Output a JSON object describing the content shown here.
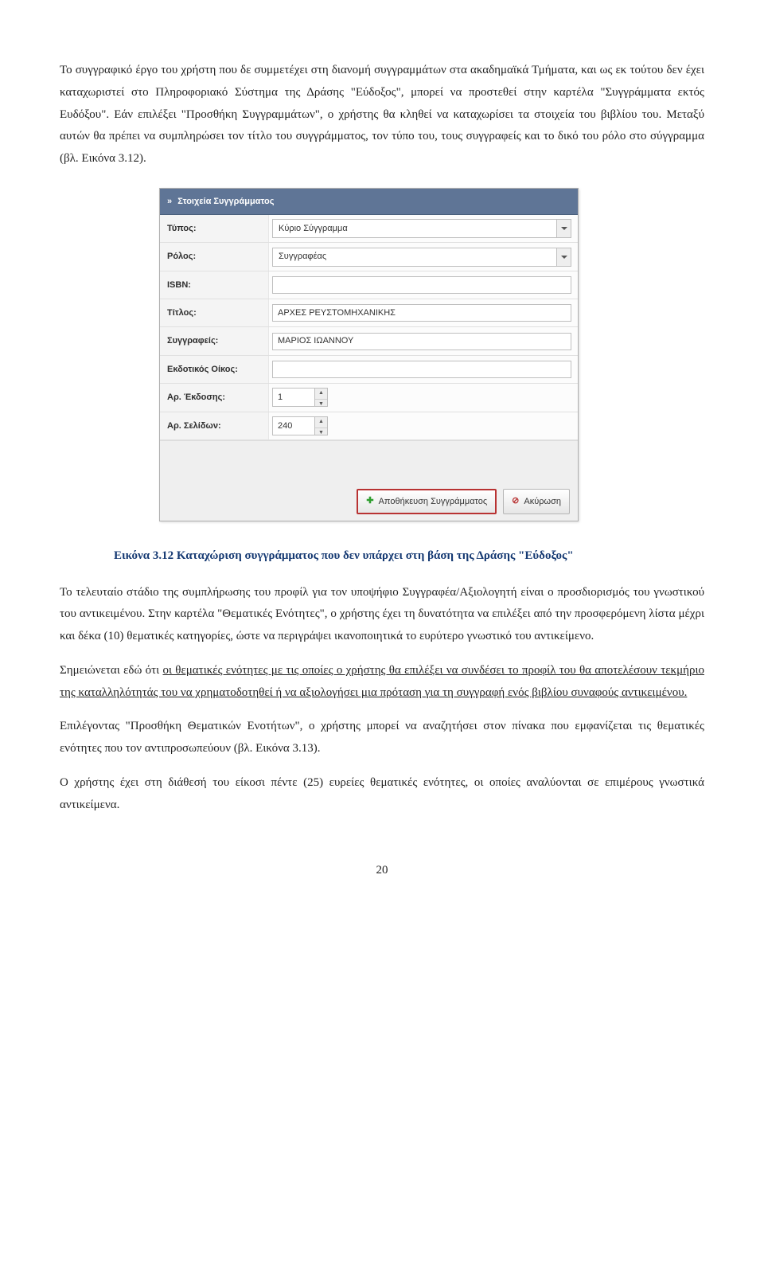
{
  "paragraphs": {
    "p1": "To συγγραφικό έργο του χρήστη που δε συμμετέχει στη διανομή συγγραμμάτων στα ακαδημαϊκά Τμήματα, και ως εκ τούτου δεν έχει καταχωριστεί στο Πληροφοριακό Σύστημα της Δράσης \"Εύδοξος\", μπορεί να προστεθεί στην καρτέλα \"Συγγράμματα εκτός Ευδόξου\". Εάν επιλέξει \"Προσθήκη Συγγραμμάτων\", ο χρήστης θα κληθεί να καταχωρίσει τα στοιχεία του βιβλίου του. Μεταξύ αυτών θα πρέπει να συμπληρώσει τον τίτλο του συγγράμματος, τον τύπο του, τους συγγραφείς και το δικό του ρόλο στο σύγγραμμα (βλ. Εικόνα 3.12).",
    "p2": "Το τελευταίο στάδιο της συμπλήρωσης του προφίλ για τον υποψήφιο Συγγραφέα/Αξιολογητή είναι ο προσδιορισμός του γνωστικού του αντικειμένου. Στην καρτέλα \"Θεματικές Ενότητες\", ο χρήστης έχει τη δυνατότητα να επιλέξει από την προσφερόμενη λίστα μέχρι και δέκα (10) θεματικές κατηγορίες, ώστε να περιγράψει ικανοποιητικά το ευρύτερο γνωστικό του αντικείμενο.",
    "p3_pre": "Σημειώνεται εδώ ότι ",
    "p3_u": "οι θεματικές ενότητες με τις οποίες ο χρήστης θα επιλέξει να συνδέσει το προφίλ του θα αποτελέσουν τεκμήριο της καταλληλότητάς του να χρηματοδοτηθεί ή να αξιολογήσει μια πρόταση για τη συγγραφή ενός βιβλίου συναφούς αντικειμένου.",
    "p4": "Επιλέγοντας \"Προσθήκη Θεματικών Ενοτήτων\", ο χρήστης μπορεί να αναζητήσει στον πίνακα που εμφανίζεται τις θεματικές ενότητες που τον αντιπροσωπεύουν (βλ. Εικόνα 3.13).",
    "p5": "Ο χρήστης έχει στη διάθεσή του είκοσι πέντε (25) ευρείες θεματικές ενότητες, οι οποίες αναλύονται σε επιμέρους γνωστικά αντικείμενα."
  },
  "caption": "Εικόνα 3.12 Καταχώριση συγγράμματος που δεν υπάρχει στη βάση της Δράσης \"Εύδοξος\"",
  "page_number": "20",
  "form": {
    "header": "Στοιχεία Συγγράμματος",
    "labels": {
      "type": "Τύπος:",
      "role": "Ρόλος:",
      "isbn": "ISBN:",
      "title": "Τίτλος:",
      "authors": "Συγγραφείς:",
      "publisher": "Εκδοτικός Οίκος:",
      "edition": "Αρ. Έκδοσης:",
      "pages": "Αρ. Σελίδων:"
    },
    "values": {
      "type": "Κύριο Σύγγραμμα",
      "role": "Συγγραφέας",
      "isbn": "",
      "title": "ΑΡΧΕΣ ΡΕΥΣΤΟΜΗΧΑΝΙΚΗΣ",
      "authors": "ΜΑΡΙΟΣ ΙΩΑΝΝΟΥ",
      "publisher": "",
      "edition": "1",
      "pages": "240"
    },
    "buttons": {
      "save": "Αποθήκευση Συγγράμματος",
      "cancel": "Ακύρωση"
    }
  }
}
